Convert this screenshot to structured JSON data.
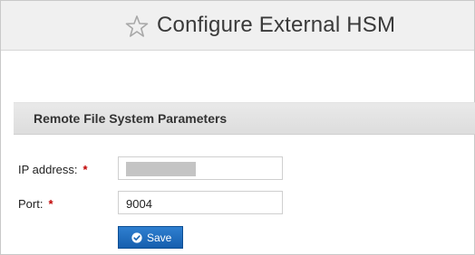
{
  "header": {
    "title": "Configure External HSM",
    "favorite_icon": "star-outline-icon"
  },
  "section": {
    "title": "Remote File System Parameters"
  },
  "form": {
    "ip_address": {
      "label": "IP address:",
      "required_marker": "*",
      "value": ""
    },
    "port": {
      "label": "Port:",
      "required_marker": "*",
      "value": "9004"
    }
  },
  "actions": {
    "save_label": "Save",
    "save_icon": "check-circle-icon"
  },
  "colors": {
    "primary_button": "#1f6fbf",
    "required": "#c00000",
    "header_bg": "#f0f0f0"
  }
}
